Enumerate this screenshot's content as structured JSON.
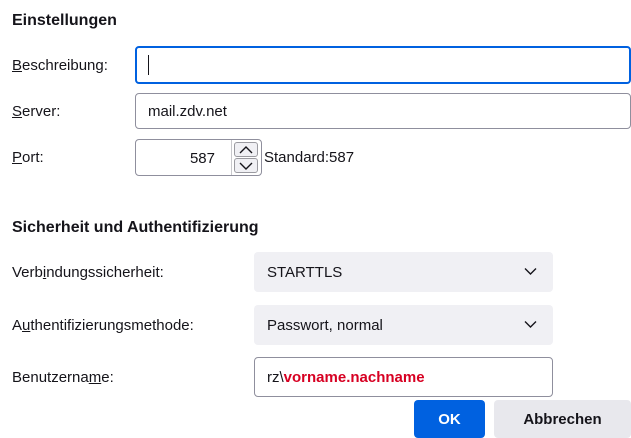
{
  "server_section": {
    "heading": "Einstellungen",
    "description": {
      "label_pre": "",
      "label_key": "B",
      "label_post": "eschreibung:",
      "value": ""
    },
    "server": {
      "label_pre": "",
      "label_key": "S",
      "label_post": "erver:",
      "value": "mail.zdv.net"
    },
    "port": {
      "label_pre": "",
      "label_key": "P",
      "label_post": "ort:",
      "value": "587",
      "default_text": "Standard:587"
    }
  },
  "security_section": {
    "heading": "Sicherheit und Authentifizierung",
    "connection_security": {
      "label_pre": "Verb",
      "label_key": "i",
      "label_post": "ndungssicherheit:",
      "selected": "STARTTLS"
    },
    "auth_method": {
      "label_pre": "A",
      "label_key": "u",
      "label_post": "thentifizierungsmethode:",
      "selected": "Passwort, normal"
    },
    "username": {
      "label_pre": "Benutzerna",
      "label_key": "m",
      "label_post": "e:",
      "value_domain": "rz\\",
      "value_name": "vorname.nachname"
    }
  },
  "buttons": {
    "ok_label": "OK",
    "cancel_label": "Abbrechen"
  },
  "colors": {
    "accent": "#0061e0",
    "username_highlight": "#d70022",
    "select_bg": "#f0f0f4"
  },
  "icons": {
    "spin_up": "chevron-up-icon",
    "spin_down": "chevron-down-icon",
    "select_arrow": "chevron-down-icon"
  }
}
